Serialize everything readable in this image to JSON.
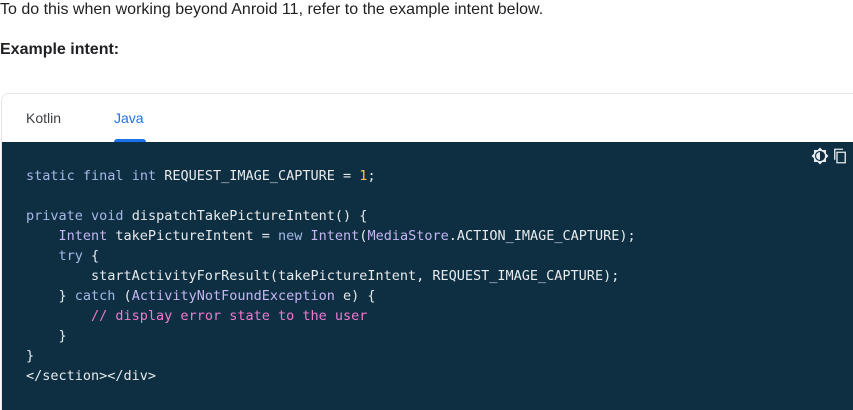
{
  "intro_text": "To do this when working beyond Anroid 11, refer to the example intent below.",
  "example_heading": "Example intent:",
  "tabs": [
    {
      "label": "Kotlin",
      "active": false
    },
    {
      "label": "Java",
      "active": true
    }
  ],
  "code_tools": {
    "theme_icon": "brightness-icon",
    "copy_icon": "copy-icon"
  },
  "colors": {
    "accent": "#1a73e8",
    "code_background": "#0d2f41",
    "keyword": "#a7b8e8",
    "number": "#fcc934",
    "type": "#c6b6f4",
    "comment": "#ee7bd0"
  },
  "code": {
    "l1": {
      "t1": "static",
      "t2": " ",
      "t3": "final",
      "t4": " ",
      "t5": "int",
      "t6": " REQUEST_IMAGE_CAPTURE = ",
      "t7": "1",
      "t8": ";"
    },
    "l3": {
      "t1": "private",
      "t2": " ",
      "t3": "void",
      "t4": " dispatchTakePictureIntent() {"
    },
    "l4": {
      "t0": "    ",
      "t1": "Intent",
      "t2": " takePictureIntent = ",
      "t3": "new",
      "t4": " ",
      "t5": "Intent",
      "t6": "(",
      "t7": "MediaStore",
      "t8": ".ACTION_IMAGE_CAPTURE);"
    },
    "l5": {
      "t0": "    ",
      "t1": "try",
      "t2": " {"
    },
    "l6": {
      "t1": "        startActivityForResult(takePictureIntent, REQUEST_IMAGE_CAPTURE);"
    },
    "l7": {
      "t1": "    } ",
      "t2": "catch",
      "t3": " (",
      "t4": "ActivityNotFoundException",
      "t5": " e) {"
    },
    "l8": {
      "t0": "        ",
      "t1": "// display error state to the user"
    },
    "l9": {
      "t1": "    }"
    },
    "l10": {
      "t1": "}"
    },
    "l11": {
      "t1": "</section></div>"
    }
  }
}
